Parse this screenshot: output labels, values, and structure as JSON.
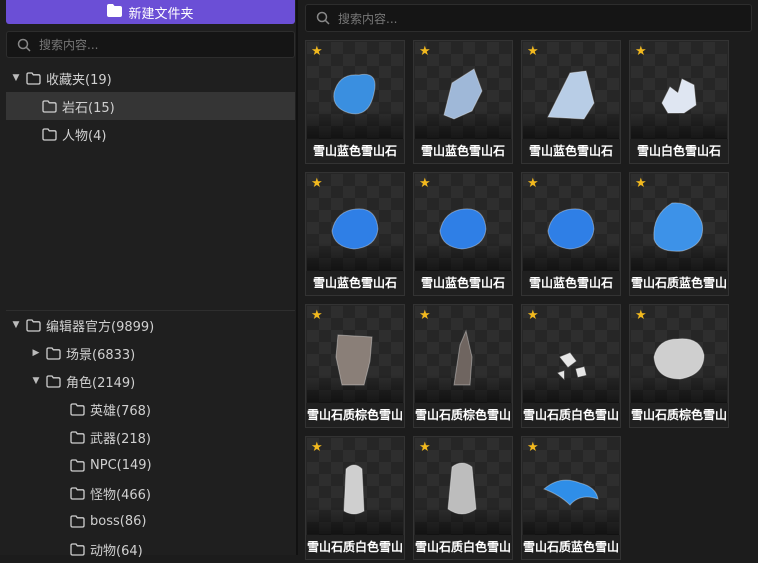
{
  "left_panel": {
    "new_folder_label": "新建文件夹",
    "search_placeholder": "搜索内容...",
    "tree": [
      {
        "label": "收藏夹(19)",
        "expanded": true
      },
      {
        "label": "岩石(15)",
        "selected": true
      },
      {
        "label": "人物(4)"
      },
      {
        "label": "编辑器官方(9899)",
        "expanded": true
      },
      {
        "label": "场景(6833)",
        "expanded": false
      },
      {
        "label": "角色(2149)",
        "expanded": true
      },
      {
        "label": "英雄(768)"
      },
      {
        "label": "武器(218)"
      },
      {
        "label": "NPC(149)"
      },
      {
        "label": "怪物(466)"
      },
      {
        "label": "boss(86)"
      },
      {
        "label": "动物(64)"
      }
    ]
  },
  "right_panel": {
    "search_placeholder": "搜索内容...",
    "assets": [
      {
        "label": "雪山蓝色雪山石",
        "favorite": true,
        "color": "#3a8fe0"
      },
      {
        "label": "雪山蓝色雪山石",
        "favorite": true,
        "color": "#9fb8d8"
      },
      {
        "label": "雪山蓝色雪山石",
        "favorite": true,
        "color": "#b8cde6"
      },
      {
        "label": "雪山白色雪山石",
        "favorite": true,
        "color": "#dfe6f2"
      },
      {
        "label": "雪山蓝色雪山石",
        "favorite": true,
        "color": "#2f7fe6"
      },
      {
        "label": "雪山蓝色雪山石",
        "favorite": true,
        "color": "#2f7fe6"
      },
      {
        "label": "雪山蓝色雪山石",
        "favorite": true,
        "color": "#2f7fe6"
      },
      {
        "label": "雪山石质蓝色雪山",
        "favorite": true,
        "color": "#3d92e8"
      },
      {
        "label": "雪山石质棕色雪山",
        "favorite": true,
        "color": "#8a7f78"
      },
      {
        "label": "雪山石质棕色雪山",
        "favorite": true,
        "color": "#6f6560"
      },
      {
        "label": "雪山石质白色雪山",
        "favorite": true,
        "color": "#e6e6e6"
      },
      {
        "label": "雪山石质棕色雪山",
        "favorite": true,
        "color": "#cfcfcf"
      },
      {
        "label": "雪山石质白色雪山",
        "favorite": true,
        "color": "#cfcfcf"
      },
      {
        "label": "雪山石质白色雪山",
        "favorite": true,
        "color": "#bdbdbd"
      },
      {
        "label": "雪山石质蓝色雪山",
        "favorite": true,
        "color": "#2f8ee8"
      }
    ]
  },
  "icons": {
    "folder": "folder-icon",
    "search": "search-icon",
    "star": "star-icon",
    "arrow_down": "chevron-down-icon",
    "arrow_right": "chevron-right-icon"
  },
  "colors": {
    "accent": "#6b4fd6",
    "star": "#f2b91e"
  }
}
